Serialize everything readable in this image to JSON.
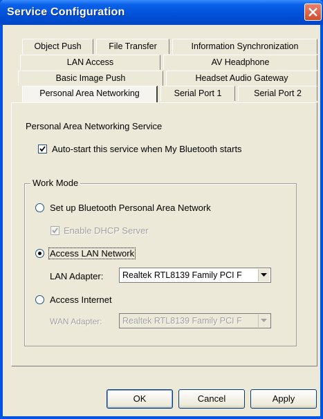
{
  "window": {
    "title": "Service Configuration"
  },
  "tabs": {
    "row1": [
      "Object Push",
      "File Transfer",
      "Information Synchronization"
    ],
    "row2": [
      "LAN Access",
      "AV Headphone"
    ],
    "row3": [
      "Basic Image Push",
      "Headset Audio Gateway"
    ],
    "row4": [
      "Personal Area Networking",
      "Serial Port 1",
      "Serial Port 2"
    ],
    "active": "Personal Area Networking"
  },
  "panel": {
    "service_title": "Personal Area Networking Service",
    "autostart_label": "Auto-start this service when My Bluetooth starts",
    "autostart_checked": true,
    "work_mode": {
      "legend": "Work Mode",
      "option_setup": "Set up Bluetooth Personal Area Network",
      "dhcp_label": "Enable DHCP Server",
      "dhcp_checked": true,
      "option_access_lan": "Access LAN Network",
      "lan_adapter_label": "LAN Adapter:",
      "lan_adapter_value": "Realtek RTL8139 Family PCI F",
      "option_access_internet": "Access Internet",
      "wan_adapter_label": "WAN Adapter:",
      "wan_adapter_value": "Realtek RTL8139 Family PCI F",
      "selected": "Access LAN Network"
    }
  },
  "buttons": {
    "ok": "OK",
    "cancel": "Cancel",
    "apply": "Apply"
  }
}
